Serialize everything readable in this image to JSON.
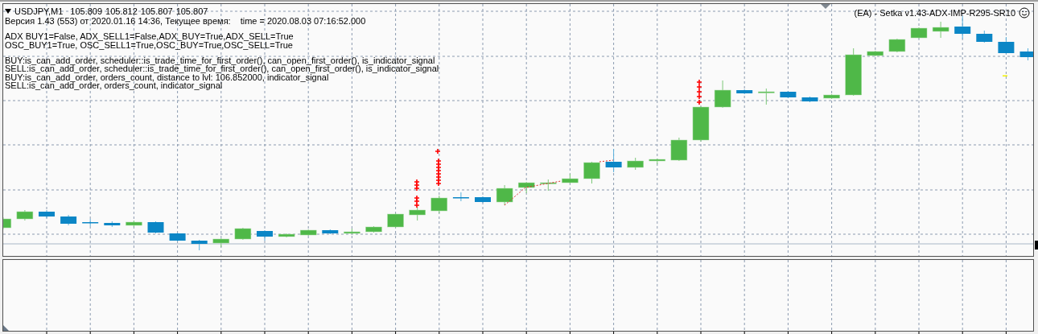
{
  "chart": {
    "symbol": "USDJPY,M1",
    "prices": [
      "105.809",
      "105.812",
      "105.807",
      "105.807"
    ],
    "version_line": "Версия 1.43 (553) от 2020.01.16 14:36, Текущее время:",
    "time_line": "time = 2020.08.03 07:16:52.000",
    "conditions": [
      "ADX BUY1=False, ADX_SELL1=False,ADX_BUY=True,ADX_SELL=True",
      "OSC_BUY1=True, OSC_SELL1=True,OSC_BUY=True,OSC_SELL=True"
    ],
    "signals": [
      "BUY:is_can_add_order, scheduler::is_trade_time_for_first_order(), can_open_first_order(), is_indicator_signal",
      "SELL:is_can_add_order, scheduler::is_trade_time_for_first_order(), can_open_first_order(), is_indicator_signal",
      "BUY:is_can_add_order, orders_count, distance to lvl: 106.852000, indicator_signal",
      "SELL:is_can_add_order, orders_count, indicator_signal"
    ],
    "expert": "(EA) - Setka v1.43-ADX-IMP-R295-SR10"
  }
}
